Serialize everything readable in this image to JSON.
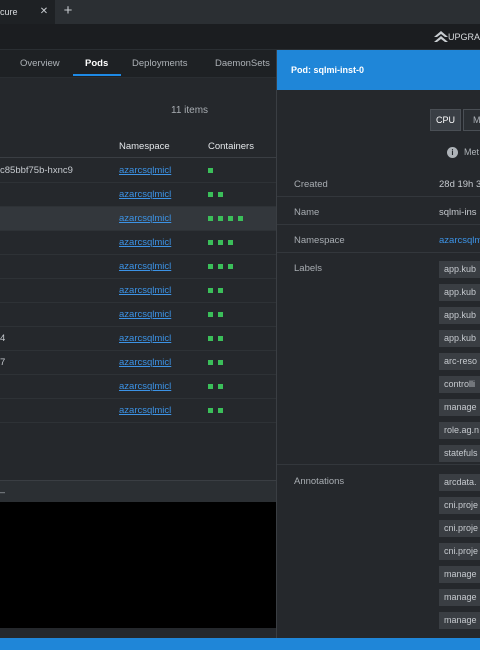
{
  "window": {
    "tab_title": "cure",
    "close_glyph": "✕",
    "new_tab_glyph": "+",
    "upgrade_label": "UPGRA"
  },
  "nav": {
    "tabs": [
      "Overview",
      "Pods",
      "Deployments",
      "DaemonSets"
    ],
    "active": "Pods"
  },
  "table": {
    "count_label": "11 items",
    "headers": {
      "namespace": "Namespace",
      "containers": "Containers"
    },
    "rows": [
      {
        "name": "c85bbf75b-hxnc9",
        "namespace": "azarcsqlmicl",
        "containers": 1,
        "selected": false
      },
      {
        "name": "",
        "namespace": "azarcsqlmicl",
        "containers": 2,
        "selected": false
      },
      {
        "name": "",
        "namespace": "azarcsqlmicl",
        "containers": 4,
        "selected": true
      },
      {
        "name": "",
        "namespace": "azarcsqlmicl",
        "containers": 3,
        "selected": false
      },
      {
        "name": "",
        "namespace": "azarcsqlmicl",
        "containers": 3,
        "selected": false
      },
      {
        "name": "",
        "namespace": "azarcsqlmicl",
        "containers": 2,
        "selected": false
      },
      {
        "name": "",
        "namespace": "azarcsqlmicl",
        "containers": 2,
        "selected": false
      },
      {
        "name": "4",
        "namespace": "azarcsqlmicl",
        "containers": 2,
        "selected": false
      },
      {
        "name": "7",
        "namespace": "azarcsqlmicl",
        "containers": 2,
        "selected": false
      },
      {
        "name": "",
        "namespace": "azarcsqlmicl",
        "containers": 2,
        "selected": false
      },
      {
        "name": "",
        "namespace": "azarcsqlmicl",
        "containers": 2,
        "selected": false
      }
    ]
  },
  "terminal": {
    "dash": "–"
  },
  "drawer": {
    "title": "Pod: sqlmi-inst-0",
    "cpu_button": "CPU",
    "memory_button": "M",
    "metrics_text": "Met",
    "properties": [
      {
        "label": "Created",
        "value": "28d 19h 3",
        "link": false
      },
      {
        "label": "Name",
        "value": "sqlmi-ins",
        "link": false
      },
      {
        "label": "Namespace",
        "value": "azarcsqlm",
        "link": true
      }
    ],
    "labels_title": "Labels",
    "labels": [
      "app.kub",
      "app.kub",
      "app.kub",
      "app.kub",
      "arc-reso",
      "controlli",
      "manage",
      "role.ag.n",
      "statefuls"
    ],
    "annotations_title": "Annotations",
    "annotations": [
      "arcdata.",
      "cni.proje",
      "cni.proje",
      "cni.proje",
      "manage",
      "manage",
      "manage"
    ]
  },
  "colors": {
    "accent": "#1f86d8",
    "link": "#3c93e6",
    "container_ok": "#3bbf5a"
  }
}
